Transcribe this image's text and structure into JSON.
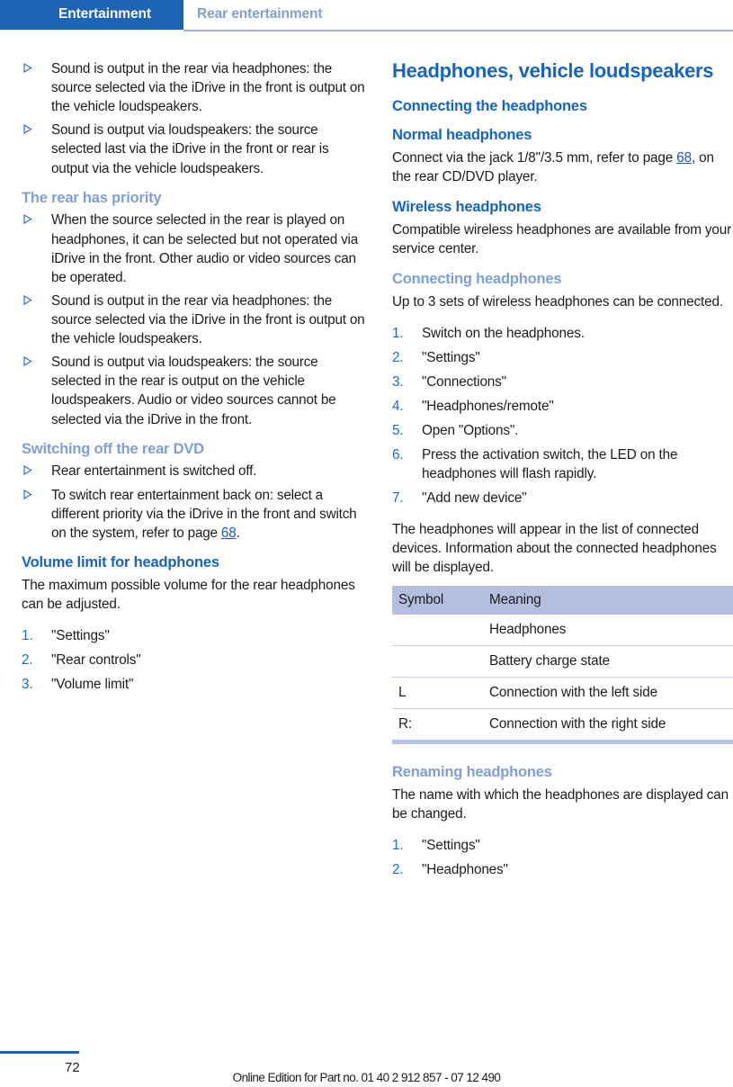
{
  "header": {
    "active_tab": "Entertainment",
    "secondary_tab": "Rear entertainment",
    "accent_color": "#1f63b5",
    "secondary_color": "#7f9fd8"
  },
  "left_column": {
    "intro_bullets": [
      "Sound is output in the rear via headphones: the source selected via the iDrive in the front is output on the vehicle loudspeakers.",
      "Sound is output via loudspeakers: the source selected last via the iDrive in the front or rear is output via the vehicle loudspeakers."
    ],
    "rear_priority": {
      "heading": "The rear has priority",
      "bullets": [
        "When the source selected in the rear is played on headphones, it can be selected but not operated via iDrive in the front. Other audio or video sources can be operated.",
        "Sound is output in the rear via headphones: the source selected via the iDrive in the front is output on the vehicle loudspeakers.",
        "Sound is output via loudspeakers: the source selected in the rear is output on the vehicle loudspeakers. Audio or video sources cannot be selected via the iDrive in the front."
      ]
    },
    "switching_off": {
      "heading": "Switching off the rear DVD",
      "bullet_1": "Rear entertainment is switched off.",
      "bullet_2_pre": "To switch rear entertainment back on: select a different priority via the iDrive in the front and switch on the system, refer to page ",
      "bullet_2_page": "68",
      "bullet_2_post": "."
    },
    "volume_limit": {
      "heading": "Volume limit for headphones",
      "intro": "The maximum possible volume for the rear headphones can be adjusted.",
      "steps": [
        "\"Settings\"",
        "\"Rear controls\"",
        "\"Volume limit\""
      ]
    }
  },
  "right_column": {
    "title": "Headphones, vehicle loudspeakers",
    "connecting_the_headphones": "Connecting the headphones",
    "normal_headphones": {
      "heading": "Normal headphones",
      "text_pre": "Connect via the jack 1/8\"/3.5 mm, refer to page ",
      "page_ref": "68",
      "text_post": ", on the rear CD/DVD player."
    },
    "wireless_headphones": {
      "heading": "Wireless headphones",
      "text": "Compatible wireless headphones are available from your service center."
    },
    "connecting_headphones": {
      "heading": "Connecting headphones",
      "intro": "Up to 3 sets of wireless headphones can be connected.",
      "steps": [
        "Switch on the headphones.",
        "\"Settings\"",
        "\"Connections\"",
        "\"Headphones/remote\"",
        "Open \"Options\".",
        "Press the activation switch, the LED on the headphones will flash rapidly.",
        "\"Add new device\""
      ],
      "outro": "The headphones will appear in the list of connected devices. Information about the connected headphones will be displayed."
    },
    "symbol_table": {
      "columns": [
        "Symbol",
        "Meaning"
      ],
      "header_bg": "#b4bfdf",
      "rows": [
        {
          "symbol": "",
          "meaning": "Headphones"
        },
        {
          "symbol": "",
          "meaning": "Battery charge state"
        },
        {
          "symbol": "L",
          "meaning": "Connection with the left side"
        },
        {
          "symbol": "R:",
          "meaning": "Connection with the right side"
        }
      ]
    },
    "renaming_headphones": {
      "heading": "Renaming headphones",
      "intro": "The name with which the headphones are displayed can be changed.",
      "steps": [
        "\"Settings\"",
        "\"Headphones\""
      ]
    }
  },
  "footer": {
    "page_number": "72",
    "note": "Online Edition for Part no. 01 40 2 912 857 - 07 12 490"
  }
}
